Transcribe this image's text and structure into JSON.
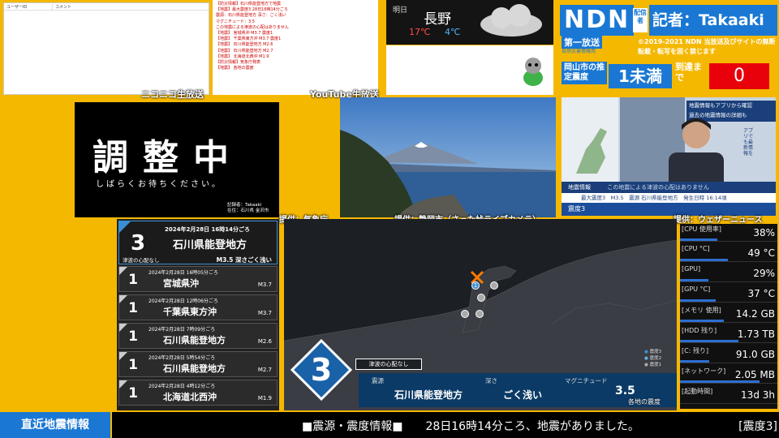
{
  "comments": {
    "col_user": "ユーザーID",
    "col_comment": "コメント",
    "caption": "ニコニコ生放送"
  },
  "youtube": {
    "caption": "YouTube生放送",
    "log": [
      "【防災情報】石川県能登地方で地震",
      "【地震】最大震度3 28日16時14分ごろ",
      "震源：石川県能登地方 深さ：ごく浅い",
      "マグニチュード：3.5",
      "この地震による津波の心配はありません",
      "【地震】 宮城県沖 M3.7 震度1",
      "【地震】 千葉県東方沖 M3.7 震度1",
      "【地震】 石川県能登地方 M2.6",
      "【地震】 石川県能登地方 M2.7",
      "【地震】 北海道北西沖 M1.9",
      "【防災情報】気象庁発表",
      "【地震】 各地の震度"
    ]
  },
  "weather": {
    "tomorrow": "明日",
    "city": "長野",
    "high": "17℃",
    "low": "4℃",
    "icon": "cloud-icon"
  },
  "ndn": {
    "logo": "NDN",
    "tag": "配信者",
    "author": "記者：Takaaki",
    "sub1": "第一放送",
    "sub2": "自然災害情報用",
    "copyright": "©2019-2021 NDN 当放送及びサイトの無断転載・転写を固く禁じます",
    "intensity_label": "岡山市の推定震度",
    "intensity_value": "1未満",
    "arrival_label": "到達まで",
    "arrival_value": "0"
  },
  "prep": {
    "main": "調整中",
    "sub": "しばらくお待ちください。",
    "rec1": "記録者：Takaaki",
    "rec2": "在住：石川県 金沢市"
  },
  "credits": {
    "jma": "提供：気象庁",
    "cam": "提供：静岡市（さった峠ライブカメラ）",
    "wn": "提供：ウェザーニュース"
  },
  "news": {
    "banner": "地震情報もアプリから確認",
    "banner2": "過去の地震情報の詳細も",
    "app": "アプリでも最新情報を",
    "title": "地震情報",
    "line": "この地震による津波の心配はありません",
    "strip": "最大震度3　M3.5　震源 石川県能登地方　発生日時 16:14頃",
    "badge": "震度3"
  },
  "quakes": [
    {
      "int": "3",
      "time": "2024年2月28日 16時14分ごろ",
      "place": "石川県能登地方",
      "mag": "M3.5 深さごく浅い",
      "note": "津波の心配なし"
    },
    {
      "int": "1",
      "time": "2024年2月28日 16時05分ごろ",
      "place": "宮城県沖",
      "mag": "M3.7"
    },
    {
      "int": "1",
      "time": "2024年2月28日 12時06分ごろ",
      "place": "千葉県東方沖",
      "mag": "M3.7"
    },
    {
      "int": "1",
      "time": "2024年2月28日 7時09分ごろ",
      "place": "石川県能登地方",
      "mag": "M2.6"
    },
    {
      "int": "1",
      "time": "2024年2月28日 5時54分ごろ",
      "place": "石川県能登地方",
      "mag": "M2.7"
    },
    {
      "int": "1",
      "time": "2024年2月28日 4時12分ごろ",
      "place": "北海道北西沖",
      "mag": "M1.9"
    }
  ],
  "map": {
    "intensity": "3",
    "tsunami": "津波の心配なし",
    "source_label": "震源",
    "source": "石川県能登地方",
    "depth_label": "深さ",
    "depth": "ごく浅い",
    "mag_label": "マグニチュード",
    "mag": "3.5",
    "each": "各地の震度",
    "legend": [
      "震度3",
      "震度2",
      "震度1"
    ],
    "epicenter_marker": "1"
  },
  "stats": [
    {
      "label": "[CPU 使用率]",
      "value": "38%",
      "pct": 38
    },
    {
      "label": "[CPU °C]",
      "value": "49 °C",
      "pct": 49
    },
    {
      "label": "[GPU]",
      "value": "29%",
      "pct": 29
    },
    {
      "label": "[GPU °C]",
      "value": "37 °C",
      "pct": 37
    },
    {
      "label": "[メモリ 使用]",
      "value": "14.2 GB",
      "pct": 45
    },
    {
      "label": "[HDD 残り]",
      "value": "1.73 TB",
      "pct": 60
    },
    {
      "label": "[C: 残り]",
      "value": "91.0 GB",
      "pct": 30
    },
    {
      "label": "[ネットワーク]",
      "value": "2.05 MB",
      "pct": 82
    },
    {
      "label": "[起動時間]",
      "value": "13d 3h",
      "pct": 0
    }
  ],
  "bottom": {
    "label": "直近地震情報",
    "ticker": "■震源・震度情報■　　28日16時14分ころ、地震がありました。",
    "right": "[震度3]"
  },
  "colors": {
    "accent": "#1a78d4",
    "bg": "#f5b800",
    "alert": "#e8000b"
  }
}
